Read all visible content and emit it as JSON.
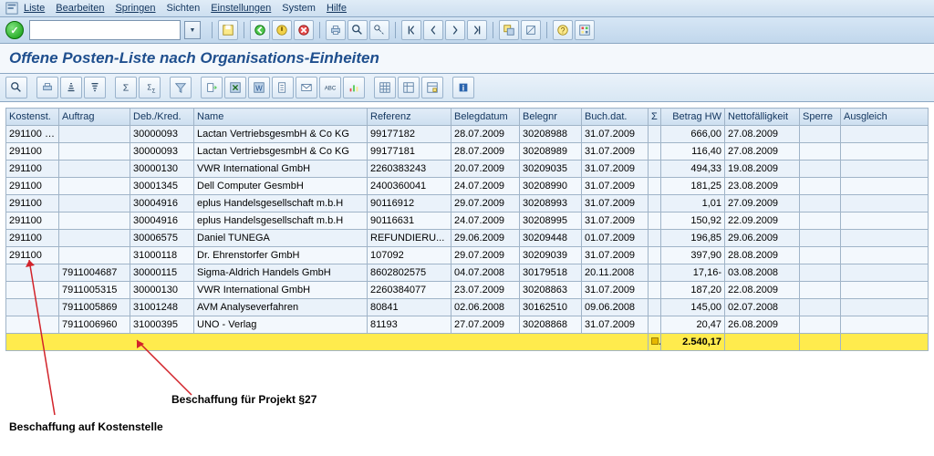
{
  "menu": {
    "items": [
      "Liste",
      "Bearbeiten",
      "Springen",
      "Sichten",
      "Einstellungen",
      "System",
      "Hilfe"
    ]
  },
  "title": "Offene Posten-Liste nach Organisations-Einheiten",
  "columns": {
    "kostenst": "Kostenst.",
    "auftrag": "Auftrag",
    "debkred": "Deb./Kred.",
    "name": "Name",
    "referenz": "Referenz",
    "belegdatum": "Belegdatum",
    "belegnr": "Belegnr",
    "buchdat": "Buch.dat.",
    "sigma": "Σ",
    "betrag": "Betrag HW",
    "nettof": "Nettofälligkeit",
    "sperre": "Sperre",
    "ausgleich": "Ausgleich"
  },
  "rows": [
    {
      "kostenst": "291100",
      "auftrag": "",
      "debkred": "30000093",
      "name": "Lactan VertriebsgesmbH & Co KG",
      "referenz": "99177182",
      "belegdatum": "28.07.2009",
      "belegnr": "30208988",
      "buchdat": "31.07.2009",
      "betrag": "666,00",
      "nettof": "27.08.2009",
      "sperre": "",
      "ausgleich": ""
    },
    {
      "kostenst": "291100",
      "auftrag": "",
      "debkred": "30000093",
      "name": "Lactan VertriebsgesmbH & Co KG",
      "referenz": "99177181",
      "belegdatum": "28.07.2009",
      "belegnr": "30208989",
      "buchdat": "31.07.2009",
      "betrag": "116,40",
      "nettof": "27.08.2009",
      "sperre": "",
      "ausgleich": ""
    },
    {
      "kostenst": "291100",
      "auftrag": "",
      "debkred": "30000130",
      "name": "VWR International GmbH",
      "referenz": "2260383243",
      "belegdatum": "20.07.2009",
      "belegnr": "30209035",
      "buchdat": "31.07.2009",
      "betrag": "494,33",
      "nettof": "19.08.2009",
      "sperre": "",
      "ausgleich": ""
    },
    {
      "kostenst": "291100",
      "auftrag": "",
      "debkred": "30001345",
      "name": "Dell Computer GesmbH",
      "referenz": "2400360041",
      "belegdatum": "24.07.2009",
      "belegnr": "30208990",
      "buchdat": "31.07.2009",
      "betrag": "181,25",
      "nettof": "23.08.2009",
      "sperre": "",
      "ausgleich": ""
    },
    {
      "kostenst": "291100",
      "auftrag": "",
      "debkred": "30004916",
      "name": "eplus Handelsgesellschaft m.b.H",
      "referenz": "90116912",
      "belegdatum": "29.07.2009",
      "belegnr": "30208993",
      "buchdat": "31.07.2009",
      "betrag": "1,01",
      "nettof": "27.09.2009",
      "sperre": "",
      "ausgleich": ""
    },
    {
      "kostenst": "291100",
      "auftrag": "",
      "debkred": "30004916",
      "name": "eplus Handelsgesellschaft m.b.H",
      "referenz": "90116631",
      "belegdatum": "24.07.2009",
      "belegnr": "30208995",
      "buchdat": "31.07.2009",
      "betrag": "150,92",
      "nettof": "22.09.2009",
      "sperre": "",
      "ausgleich": ""
    },
    {
      "kostenst": "291100",
      "auftrag": "",
      "debkred": "30006575",
      "name": "Daniel TUNEGA",
      "referenz": "REFUNDIERU...",
      "belegdatum": "29.06.2009",
      "belegnr": "30209448",
      "buchdat": "01.07.2009",
      "betrag": "196,85",
      "nettof": "29.06.2009",
      "sperre": "",
      "ausgleich": ""
    },
    {
      "kostenst": "291100",
      "auftrag": "",
      "debkred": "31000118",
      "name": "Dr. Ehrenstorfer GmbH",
      "referenz": "107092",
      "belegdatum": "29.07.2009",
      "belegnr": "30209039",
      "buchdat": "31.07.2009",
      "betrag": "397,90",
      "nettof": "28.08.2009",
      "sperre": "",
      "ausgleich": ""
    },
    {
      "kostenst": "",
      "auftrag": "7911004687",
      "debkred": "30000115",
      "name": "Sigma-Aldrich Handels GmbH",
      "referenz": "8602802575",
      "belegdatum": "04.07.2008",
      "belegnr": "30179518",
      "buchdat": "20.11.2008",
      "betrag": "17,16-",
      "nettof": "03.08.2008",
      "sperre": "",
      "ausgleich": ""
    },
    {
      "kostenst": "",
      "auftrag": "7911005315",
      "debkred": "30000130",
      "name": "VWR International GmbH",
      "referenz": "2260384077",
      "belegdatum": "23.07.2009",
      "belegnr": "30208863",
      "buchdat": "31.07.2009",
      "betrag": "187,20",
      "nettof": "22.08.2009",
      "sperre": "",
      "ausgleich": ""
    },
    {
      "kostenst": "",
      "auftrag": "7911005869",
      "debkred": "31001248",
      "name": "AVM Analyseverfahren",
      "referenz": "80841",
      "belegdatum": "02.06.2008",
      "belegnr": "30162510",
      "buchdat": "09.06.2008",
      "betrag": "145,00",
      "nettof": "02.07.2008",
      "sperre": "",
      "ausgleich": ""
    },
    {
      "kostenst": "",
      "auftrag": "7911006960",
      "debkred": "31000395",
      "name": "UNO - Verlag",
      "referenz": "81193",
      "belegdatum": "27.07.2009",
      "belegnr": "30208868",
      "buchdat": "31.07.2009",
      "betrag": "20,47",
      "nettof": "26.08.2009",
      "sperre": "",
      "ausgleich": ""
    }
  ],
  "total_label": "",
  "total_value": "2.540,17",
  "annotations": {
    "kostenstelle": "Beschaffung auf Kostenstelle",
    "projekt": "Beschaffung für Projekt §27"
  }
}
